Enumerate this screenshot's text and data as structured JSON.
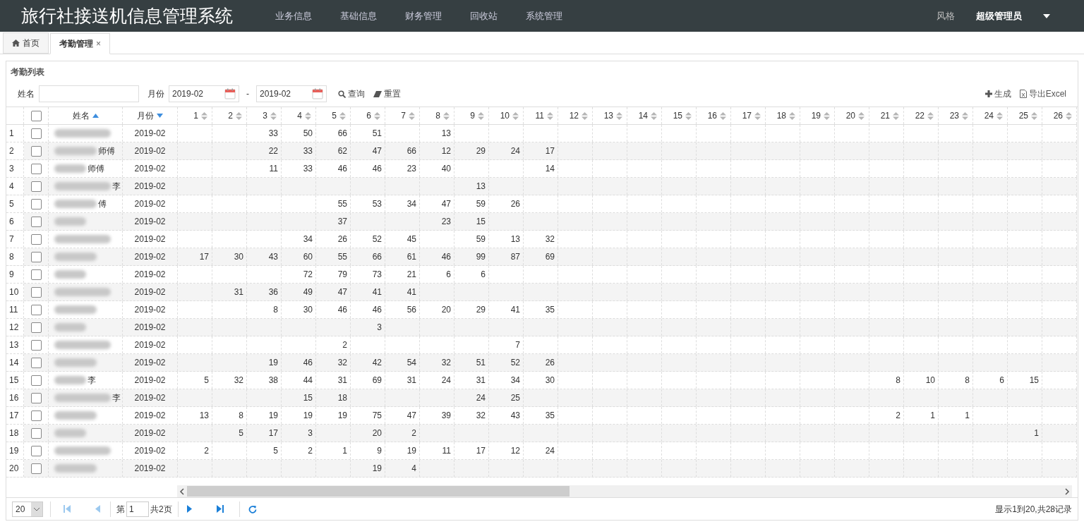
{
  "header": {
    "title": "旅行社接送机信息管理系统",
    "menu": [
      {
        "label": "业务信息"
      },
      {
        "label": "基础信息"
      },
      {
        "label": "财务管理"
      },
      {
        "label": "回收站"
      },
      {
        "label": "系统管理"
      }
    ],
    "style_link": "风格",
    "user": "超级管理员"
  },
  "tabs": [
    {
      "label": "首页",
      "kind": "home",
      "selected": false
    },
    {
      "label": "考勤管理",
      "kind": "closable",
      "close": "×",
      "selected": true
    }
  ],
  "panel": {
    "title": "考勤列表",
    "filters": {
      "name_label": "姓名",
      "month_label": "月份",
      "month_from": "2019-02",
      "separator": "-",
      "month_to": "2019-02",
      "search_button": "查询",
      "reset_button": "重置"
    },
    "actions": [
      {
        "label": "生成",
        "kind": "add"
      },
      {
        "label": "导出Excel",
        "kind": "excel"
      }
    ],
    "table": {
      "header_checked": false,
      "columns": [
        {
          "label": "姓名",
          "kind": "ascending"
        },
        {
          "label": "月份",
          "kind": "descending"
        },
        {
          "label": "1",
          "kind": "sortable"
        },
        {
          "label": "2",
          "kind": "sortable"
        },
        {
          "label": "3",
          "kind": "sortable"
        },
        {
          "label": "4",
          "kind": "sortable"
        },
        {
          "label": "5",
          "kind": "sortable"
        },
        {
          "label": "6",
          "kind": "sortable"
        },
        {
          "label": "7",
          "kind": "sortable"
        },
        {
          "label": "8",
          "kind": "sortable"
        },
        {
          "label": "9",
          "kind": "sortable"
        },
        {
          "label": "10",
          "kind": "sortable"
        },
        {
          "label": "11",
          "kind": "sortable"
        },
        {
          "label": "12",
          "kind": "sortable"
        },
        {
          "label": "13",
          "kind": "sortable"
        },
        {
          "label": "14",
          "kind": "sortable"
        },
        {
          "label": "15",
          "kind": "sortable"
        },
        {
          "label": "16",
          "kind": "sortable"
        },
        {
          "label": "17",
          "kind": "sortable"
        },
        {
          "label": "18",
          "kind": "sortable"
        },
        {
          "label": "19",
          "kind": "sortable"
        },
        {
          "label": "20",
          "kind": "sortable"
        },
        {
          "label": "21",
          "kind": "sortable"
        },
        {
          "label": "22",
          "kind": "sortable"
        },
        {
          "label": "23",
          "kind": "sortable"
        },
        {
          "label": "24",
          "kind": "sortable"
        },
        {
          "label": "25",
          "kind": "sortable"
        },
        {
          "label": "26",
          "kind": "sortable"
        }
      ],
      "rows": [
        {
          "no": "1",
          "checked": false,
          "month": "2019-02",
          "days": {
            "day_3": "33",
            "day_4": "50",
            "day_5": "66",
            "day_6": "51",
            "day_8": "13"
          }
        },
        {
          "no": "2",
          "checked": false,
          "name": "师傅",
          "month": "2019-02",
          "days": {
            "day_3": "22",
            "day_4": "33",
            "day_5": "62",
            "day_6": "47",
            "day_7": "66",
            "day_8": "12",
            "day_9": "29",
            "day_10": "24",
            "day_11": "17"
          }
        },
        {
          "no": "3",
          "checked": false,
          "name": "师傅",
          "month": "2019-02",
          "days": {
            "day_3": "11",
            "day_4": "33",
            "day_5": "46",
            "day_6": "46",
            "day_7": "23",
            "day_8": "40",
            "day_11": "14"
          }
        },
        {
          "no": "4",
          "checked": false,
          "name": "李",
          "month": "2019-02",
          "days": {
            "day_9": "13"
          }
        },
        {
          "no": "5",
          "checked": false,
          "name": "傅",
          "month": "2019-02",
          "days": {
            "day_5": "55",
            "day_6": "53",
            "day_7": "34",
            "day_8": "47",
            "day_9": "59",
            "day_10": "26"
          }
        },
        {
          "no": "6",
          "checked": false,
          "month": "2019-02",
          "days": {
            "day_5": "37",
            "day_8": "23",
            "day_9": "15"
          }
        },
        {
          "no": "7",
          "checked": false,
          "month": "2019-02",
          "days": {
            "day_4": "34",
            "day_5": "26",
            "day_6": "52",
            "day_7": "45",
            "day_9": "59",
            "day_10": "13",
            "day_11": "32"
          }
        },
        {
          "no": "8",
          "checked": false,
          "month": "2019-02",
          "days": {
            "day_1": "17",
            "day_2": "30",
            "day_3": "43",
            "day_4": "60",
            "day_5": "55",
            "day_6": "66",
            "day_7": "61",
            "day_8": "46",
            "day_9": "99",
            "day_10": "87",
            "day_11": "69"
          }
        },
        {
          "no": "9",
          "checked": false,
          "month": "2019-02",
          "days": {
            "day_4": "72",
            "day_5": "79",
            "day_6": "73",
            "day_7": "21",
            "day_8": "6",
            "day_9": "6"
          }
        },
        {
          "no": "10",
          "checked": false,
          "month": "2019-02",
          "days": {
            "day_2": "31",
            "day_3": "36",
            "day_4": "49",
            "day_5": "47",
            "day_6": "41",
            "day_7": "41"
          }
        },
        {
          "no": "11",
          "checked": false,
          "month": "2019-02",
          "days": {
            "day_3": "8",
            "day_4": "30",
            "day_5": "46",
            "day_6": "46",
            "day_7": "56",
            "day_8": "20",
            "day_9": "29",
            "day_10": "41",
            "day_11": "35"
          }
        },
        {
          "no": "12",
          "checked": false,
          "month": "2019-02",
          "days": {
            "day_6": "3"
          }
        },
        {
          "no": "13",
          "checked": false,
          "month": "2019-02",
          "days": {
            "day_5": "2",
            "day_10": "7"
          }
        },
        {
          "no": "14",
          "checked": false,
          "month": "2019-02",
          "days": {
            "day_3": "19",
            "day_4": "46",
            "day_5": "32",
            "day_6": "42",
            "day_7": "54",
            "day_8": "32",
            "day_9": "51",
            "day_10": "52",
            "day_11": "26"
          }
        },
        {
          "no": "15",
          "checked": false,
          "name": "李",
          "month": "2019-02",
          "days": {
            "day_1": "5",
            "day_2": "32",
            "day_3": "38",
            "day_4": "44",
            "day_5": "31",
            "day_6": "69",
            "day_7": "31",
            "day_8": "24",
            "day_9": "31",
            "day_10": "34",
            "day_11": "30",
            "day_21": "8",
            "day_22": "10",
            "day_23": "8",
            "day_24": "6",
            "day_25": "15"
          }
        },
        {
          "no": "16",
          "checked": false,
          "name": "李",
          "month": "2019-02",
          "days": {
            "day_4": "15",
            "day_5": "18",
            "day_9": "24",
            "day_10": "25"
          }
        },
        {
          "no": "17",
          "checked": false,
          "month": "2019-02",
          "days": {
            "day_1": "13",
            "day_2": "8",
            "day_3": "19",
            "day_4": "19",
            "day_5": "19",
            "day_6": "75",
            "day_7": "47",
            "day_8": "39",
            "day_9": "32",
            "day_10": "43",
            "day_11": "35",
            "day_21": "2",
            "day_22": "1",
            "day_23": "1"
          }
        },
        {
          "no": "18",
          "checked": false,
          "month": "2019-02",
          "days": {
            "day_2": "5",
            "day_3": "17",
            "day_4": "3",
            "day_6": "20",
            "day_7": "2",
            "day_25": "1"
          }
        },
        {
          "no": "19",
          "checked": false,
          "month": "2019-02",
          "days": {
            "day_1": "2",
            "day_3": "5",
            "day_4": "2",
            "day_5": "1",
            "day_6": "9",
            "day_7": "19",
            "day_8": "11",
            "day_9": "17",
            "day_10": "12",
            "day_11": "24"
          }
        },
        {
          "no": "20",
          "checked": false,
          "month": "2019-02",
          "days": {
            "day_6": "19",
            "day_7": "4"
          }
        }
      ]
    },
    "pagination": {
      "page_size": "20",
      "page_prefix": "第",
      "page": "1",
      "page_suffix": "共2页",
      "summary": "显示1到20,共28记录"
    }
  }
}
